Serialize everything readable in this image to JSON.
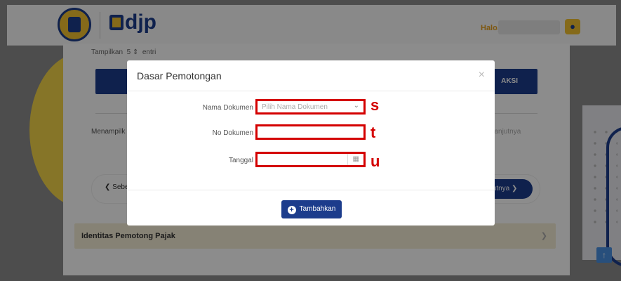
{
  "header": {
    "brand": "djp",
    "greeting": "Halo,",
    "user_icon": "user-icon"
  },
  "background": {
    "show_entries": {
      "label": "Tampilkan",
      "value": "5",
      "suffix": "entri"
    },
    "table": {
      "actions_header": "AKSI"
    },
    "showing_text": "Menampilk",
    "next_link": "Selanjutnya",
    "pager": {
      "prev": "Sebe",
      "next": "ikutnya"
    },
    "section_title": "Identitas Pemotong Pajak",
    "scroll_top_icon": "arrow-up-icon"
  },
  "modal": {
    "title": "Dasar Pemotongan",
    "close_icon": "close-icon",
    "fields": {
      "document_name": {
        "label": "Nama Dokumen",
        "placeholder": "Pilih Nama Dokumen",
        "annotation": "s"
      },
      "document_number": {
        "label": "No Dokumen",
        "value": "",
        "annotation": "t"
      },
      "date": {
        "label": "Tanggal",
        "value": "",
        "annotation": "u"
      }
    },
    "submit_label": "Tambahkan"
  },
  "colors": {
    "brand_navy": "#1c3c8c",
    "brand_gold": "#f2c230",
    "annotation_red": "#d40000"
  }
}
